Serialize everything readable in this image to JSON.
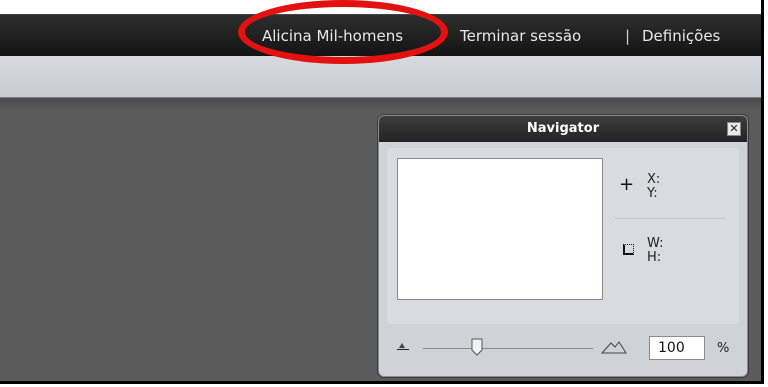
{
  "header": {
    "user_name": "Alicina Mil-homens",
    "logout_label": "Terminar sessão",
    "separator": "|",
    "settings_label": "Definições"
  },
  "navigator": {
    "title": "Navigator",
    "close_symbol": "✕",
    "x_label": "X:",
    "y_label": "Y:",
    "w_label": "W:",
    "h_label": "H:",
    "zoom_value": "100",
    "zoom_unit": "%",
    "zoom_slider_position": 0.32
  },
  "icons": {
    "crosshair": "crosshair-icon",
    "dimension": "dimension-icon",
    "zoom_out": "mountain-small-icon",
    "zoom_in": "mountain-large-icon",
    "close": "close-icon"
  },
  "colors": {
    "annotation": "#e41111",
    "topbar": "#1e1e1e",
    "workspace": "#5b5b5b",
    "panel": "#cfd2d6"
  }
}
